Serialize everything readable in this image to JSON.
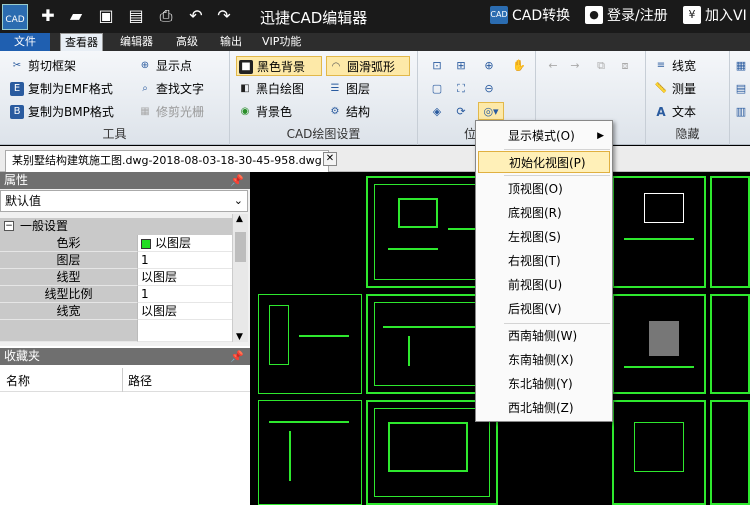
{
  "titlebar": {
    "logo_text": "CAD",
    "app_title": "迅捷CAD编辑器",
    "quick_icons": [
      "new-icon",
      "open-folder-icon",
      "save-icon",
      "save-as-icon",
      "print-icon",
      "undo-icon",
      "redo-icon"
    ],
    "cad_convert": "CAD转换",
    "login": "登录/注册",
    "join_vip": "加入VI",
    "cad_convert_icon_text": "CAD",
    "yen_symbol": "¥"
  },
  "menubar": {
    "items": [
      "文件",
      "查看器",
      "编辑器",
      "高级",
      "输出",
      "VIP功能"
    ],
    "active_index": 1
  },
  "ribbon": {
    "tools": {
      "label": "工具",
      "items": [
        "剪切框架",
        "复制为EMF格式",
        "复制为BMP格式",
        "显示点",
        "查找文字",
        "修剪光栅"
      ]
    },
    "cad_settings": {
      "label": "CAD绘图设置",
      "items": [
        "黑色背景",
        "圆滑弧形",
        "黑白绘图",
        "图层",
        "背景色",
        "结构"
      ]
    },
    "position": {
      "label": "位"
    },
    "hide": {
      "label": "隐藏",
      "items": [
        "线宽",
        "测量",
        "文本"
      ]
    }
  },
  "document_tab": {
    "name": "某别墅结构建筑施工图.dwg-2018-08-03-18-30-45-958.dwg",
    "close_glyph": "✕"
  },
  "properties": {
    "header": "属性",
    "dropdown_value": "默认值",
    "section": "一般设置",
    "rows": [
      {
        "key": "色彩",
        "value": "以图层"
      },
      {
        "key": "图层",
        "value": "1"
      },
      {
        "key": "线型",
        "value": "以图层"
      },
      {
        "key": "线型比例",
        "value": "1"
      },
      {
        "key": "线宽",
        "value": "以图层"
      }
    ],
    "color_swatch": "#22dd22"
  },
  "favorites": {
    "header": "收藏夹",
    "columns": [
      "名称",
      "路径"
    ]
  },
  "context_menu": {
    "items": [
      "显示模式(O)",
      "初始化视图(P)",
      "顶视图(O)",
      "底视图(R)",
      "左视图(S)",
      "右视图(T)",
      "前视图(U)",
      "后视图(V)",
      "西南轴侧(W)",
      "东南轴侧(X)",
      "东北轴侧(Y)",
      "西北轴侧(Z)"
    ],
    "highlighted_index": 1
  },
  "colors": {
    "drawing_green": "#2ee82e",
    "highlight": "#fde9a8",
    "file_menu_blue": "#1f5fb0"
  }
}
